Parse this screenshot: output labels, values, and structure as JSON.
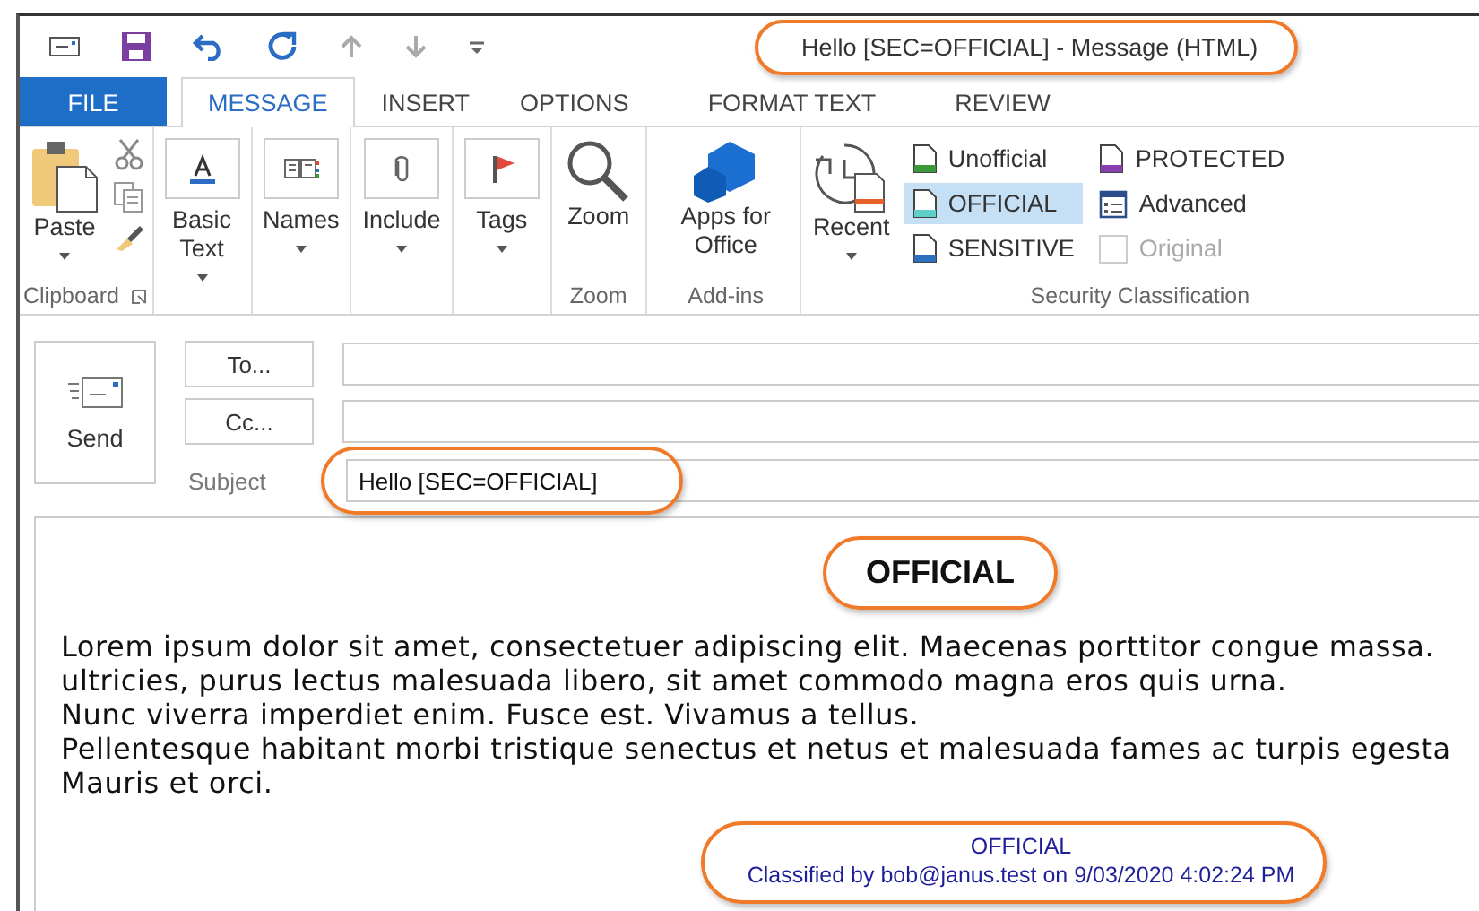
{
  "window": {
    "title": "Hello [SEC=OFFICIAL] - Message (HTML)",
    "highlighted": true
  },
  "tabs": [
    {
      "label": "FILE",
      "kind": "file",
      "selected": false
    },
    {
      "label": "MESSAGE",
      "kind": "tab",
      "selected": true
    },
    {
      "label": "INSERT",
      "kind": "tab",
      "selected": false
    },
    {
      "label": "OPTIONS",
      "kind": "tab",
      "selected": false
    },
    {
      "label": "FORMAT TEXT",
      "kind": "tab",
      "selected": false
    },
    {
      "label": "REVIEW",
      "kind": "tab",
      "selected": false
    }
  ],
  "ribbon": {
    "groups": [
      {
        "label": "Clipboard",
        "launcher": true,
        "items": [
          {
            "kind": "large",
            "label": "Paste",
            "dropdown": true
          },
          {
            "kind": "small-icons"
          }
        ]
      },
      {
        "items": [
          {
            "kind": "framed",
            "label": "Basic Text",
            "dropdown": true
          }
        ]
      },
      {
        "items": [
          {
            "kind": "framed",
            "label": "Names",
            "dropdown": true
          }
        ]
      },
      {
        "items": [
          {
            "kind": "framed",
            "label": "Include",
            "dropdown": true
          }
        ]
      },
      {
        "items": [
          {
            "kind": "framed",
            "label": "Tags",
            "dropdown": true
          }
        ]
      },
      {
        "label": "Zoom",
        "items": [
          {
            "kind": "large",
            "label": "Zoom",
            "dropdown": false
          }
        ]
      },
      {
        "label": "Add-ins",
        "items": [
          {
            "kind": "large",
            "label": "Apps for Office",
            "dropdown": false
          }
        ]
      },
      {
        "label": "Security Classification",
        "items": [
          {
            "kind": "large",
            "label": "Recent",
            "dropdown": true
          },
          {
            "kind": "column",
            "entries": [
              {
                "kind": "doc",
                "label": "Unofficial",
                "color": "#3a9a3a",
                "selected": false
              },
              {
                "kind": "doc",
                "label": "OFFICIAL",
                "color": "#5ccfc8",
                "selected": true
              },
              {
                "kind": "doc",
                "label": "SENSITIVE",
                "color": "#2f6fc0",
                "selected": false
              }
            ]
          },
          {
            "kind": "column",
            "entries": [
              {
                "kind": "doc",
                "label": "PROTECTED",
                "color": "#8a3fb0",
                "selected": false
              },
              {
                "kind": "button",
                "label": "Advanced"
              },
              {
                "kind": "checkbox",
                "label": "Original",
                "checked": false,
                "disabled": true
              }
            ]
          }
        ]
      }
    ]
  },
  "compose": {
    "send": {
      "label": "Send"
    },
    "recipients": [
      {
        "label": "To..."
      },
      {
        "label": "Cc..."
      }
    ],
    "subject": {
      "label": "Subject",
      "value": "Hello [SEC=OFFICIAL]",
      "highlighted": true
    }
  },
  "body": {
    "banner": {
      "text": "OFFICIAL",
      "highlighted": true
    },
    "lines": [
      "Lorem ipsum dolor sit amet, consectetuer adipiscing elit. Maecenas porttitor congue massa.",
      "ultricies, purus lectus malesuada libero, sit amet commodo magna eros quis urna.",
      "Nunc viverra imperdiet enim. Fusce est. Vivamus a tellus.",
      "Pellentesque habitant morbi tristique senectus et netus et malesuada fames ac turpis egesta",
      "Mauris et orci."
    ],
    "footer": {
      "lines": [
        "OFFICIAL",
        "Classified by bob@janus.test on 9/03/2020 4:02:24 PM"
      ],
      "highlighted": true
    }
  }
}
